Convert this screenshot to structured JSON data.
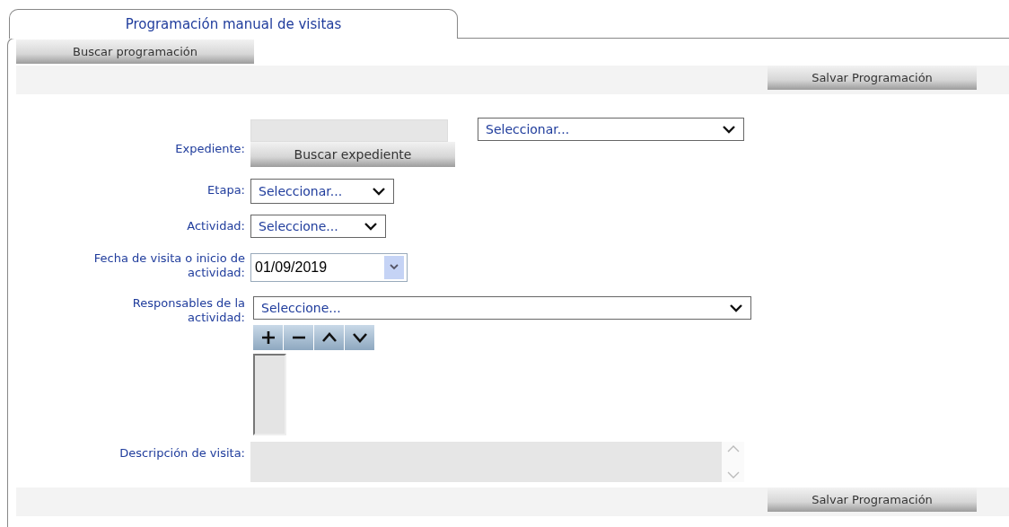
{
  "tab": {
    "label": "Programación manual de visitas",
    "selected": true
  },
  "search_button": "Buscar programación",
  "toolbar_top": {
    "save_button": "Salvar Programación"
  },
  "form": {
    "expediente": {
      "label": "Expediente:",
      "value_disabled": true,
      "dropdown": "Seleccionar...",
      "search_button": "Buscar expediente"
    },
    "etapa": {
      "label": "Etapa:",
      "dropdown": "Seleccionar..."
    },
    "actividad": {
      "label": "Actividad:",
      "dropdown": "Seleccione..."
    },
    "fecha": {
      "label": "Fecha de visita o inicio de actividad:",
      "value": "01/09/2019"
    },
    "responsables": {
      "label": "Responsables de la actividad:",
      "dropdown": "Seleccione...",
      "list_buttons": [
        {
          "kind": "add"
        },
        {
          "kind": "remove"
        },
        {
          "kind": "up"
        },
        {
          "kind": "down"
        }
      ]
    },
    "descripcion": {
      "label": "Descripción de visita:",
      "disabled": true
    }
  },
  "toolbar_bottom": {
    "save_button": "Salvar Programación"
  }
}
